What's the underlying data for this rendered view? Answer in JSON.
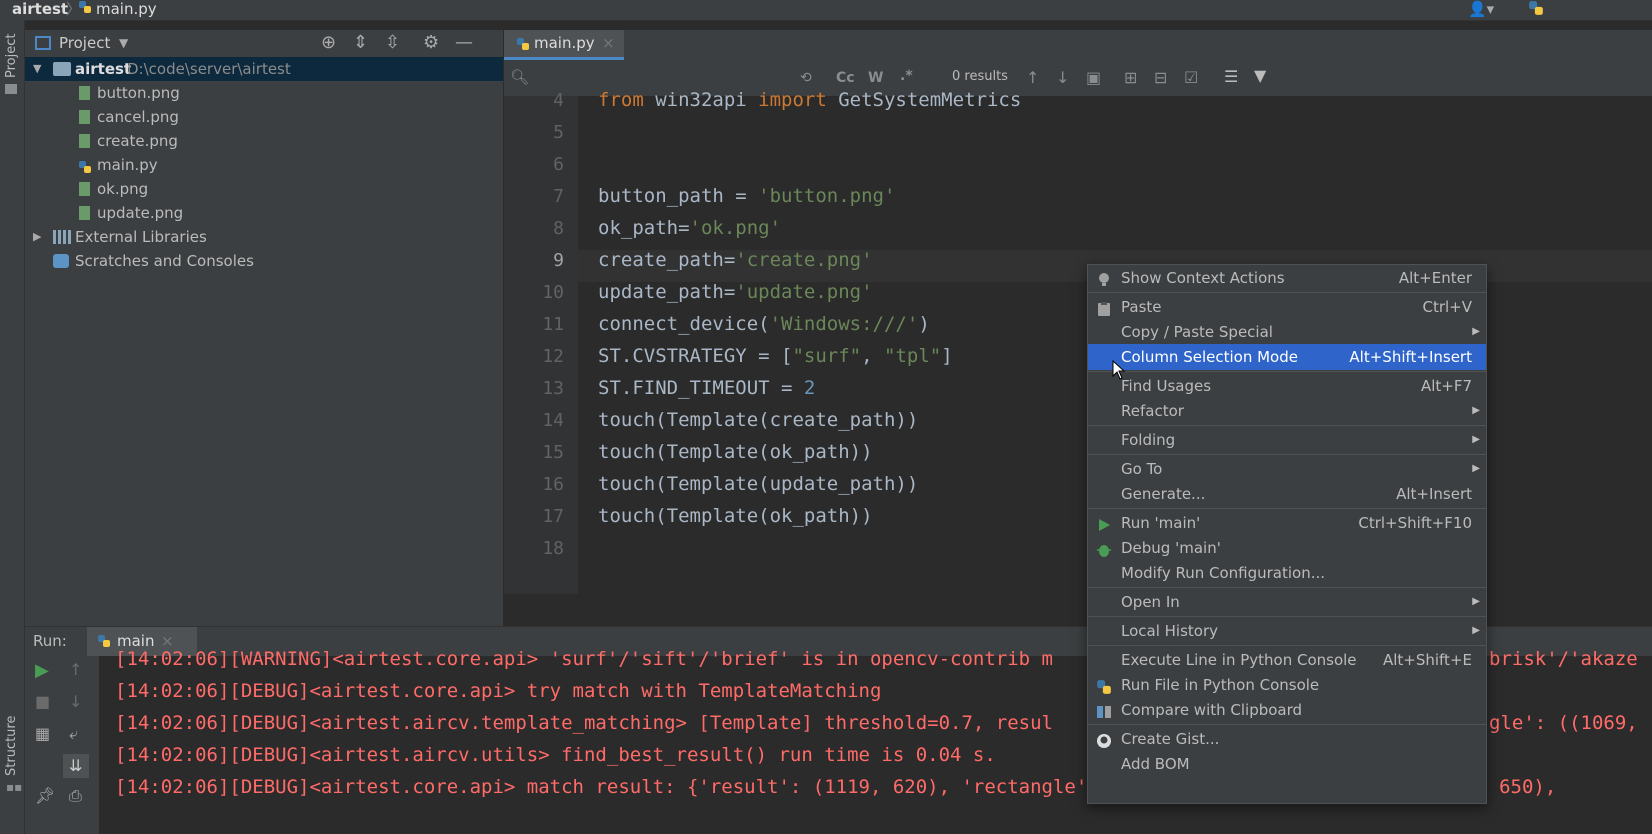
{
  "breadcrumb": {
    "project": "airtest",
    "file": "main.py"
  },
  "sidebar_strip": {
    "project_label": "Project",
    "structure_label": "Structure"
  },
  "project_panel": {
    "title": "Project",
    "root": {
      "name": "airtest",
      "path": "D:\\code\\server\\airtest"
    },
    "files": [
      "button.png",
      "cancel.png",
      "create.png",
      "main.py",
      "ok.png",
      "update.png"
    ],
    "external_libraries": "External Libraries",
    "scratches": "Scratches and Consoles"
  },
  "editor": {
    "tab": "main.py",
    "find": {
      "results": "0 results",
      "case_toggle": "Cc",
      "word_toggle": "W",
      "regex_toggle": ".*"
    },
    "current_line": "9",
    "lines": [
      {
        "n": "4",
        "text": "from win32api import GetSystemMetrics"
      },
      {
        "n": "5",
        "text": ""
      },
      {
        "n": "6",
        "text": ""
      },
      {
        "n": "7",
        "text": "button_path = 'button.png'"
      },
      {
        "n": "8",
        "text": "ok_path='ok.png'"
      },
      {
        "n": "9",
        "text": "create_path='create.png'"
      },
      {
        "n": "10",
        "text": "update_path='update.png'"
      },
      {
        "n": "11",
        "text": "connect_device('Windows:///')"
      },
      {
        "n": "12",
        "text": "ST.CVSTRATEGY = [\"surf\", \"tpl\"]"
      },
      {
        "n": "13",
        "text": "ST.FIND_TIMEOUT = 2"
      },
      {
        "n": "14",
        "text": "touch(Template(create_path))"
      },
      {
        "n": "15",
        "text": "touch(Template(ok_path))"
      },
      {
        "n": "16",
        "text": "touch(Template(update_path))"
      },
      {
        "n": "17",
        "text": "touch(Template(ok_path))"
      },
      {
        "n": "18",
        "text": ""
      }
    ]
  },
  "run_panel": {
    "label": "Run:",
    "tab": "main",
    "lines": [
      "[14:02:06][WARNING]<airtest.core.api> 'surf'/'sift'/'brief' is in opencv-contrib m",
      "[14:02:06][DEBUG]<airtest.core.api> try match with TemplateMatching",
      "[14:02:06][DEBUG]<airtest.aircv.template_matching> [Template] threshold=0.7, resul",
      "[14:02:06][DEBUG]<airtest.aircv.utils> find_best_result() run time is 0.04 s.",
      "[14:02:06][DEBUG]<airtest.core.api> match result: {'result': (1119, 620), 'rectangle': ((1069, 590), (1069, 650), (1169, 650),"
    ],
    "right_fragments": [
      "brisk'/'akaze",
      "gle': ((1069,"
    ]
  },
  "context_menu": {
    "items": [
      {
        "label": "Show Context Actions",
        "shortcut": "Alt+Enter",
        "icon": "bulb-icon"
      },
      {
        "label": "Paste",
        "shortcut": "Ctrl+V",
        "icon": "clipboard-icon"
      },
      {
        "label": "Copy / Paste Special",
        "shortcut": "",
        "submenu": true
      },
      {
        "label": "Column Selection Mode",
        "shortcut": "Alt+Shift+Insert",
        "highlighted": true
      },
      {
        "label": "Find Usages",
        "shortcut": "Alt+F7"
      },
      {
        "label": "Refactor",
        "shortcut": "",
        "submenu": true
      },
      {
        "label": "Folding",
        "shortcut": "",
        "submenu": true
      },
      {
        "label": "Go To",
        "shortcut": "",
        "submenu": true
      },
      {
        "label": "Generate...",
        "shortcut": "Alt+Insert"
      },
      {
        "label": "Run 'main'",
        "shortcut": "Ctrl+Shift+F10",
        "icon": "run-icon"
      },
      {
        "label": "Debug 'main'",
        "shortcut": "",
        "icon": "debug-icon"
      },
      {
        "label": "Modify Run Configuration...",
        "shortcut": ""
      },
      {
        "label": "Open In",
        "shortcut": "",
        "submenu": true
      },
      {
        "label": "Local History",
        "shortcut": "",
        "submenu": true
      },
      {
        "label": "Execute Line in Python Console",
        "shortcut": "Alt+Shift+E"
      },
      {
        "label": "Run File in Python Console",
        "shortcut": "",
        "icon": "python-icon"
      },
      {
        "label": "Compare with Clipboard",
        "shortcut": "",
        "icon": "compare-icon"
      },
      {
        "label": "Create Gist...",
        "shortcut": "",
        "icon": "github-icon"
      },
      {
        "label": "Add BOM",
        "shortcut": ""
      }
    ]
  },
  "colors": {
    "highlight": "#2f65ca",
    "error_text": "#ff6b68",
    "keyword": "#cc7832",
    "string": "#6a8759",
    "number": "#6897bb"
  }
}
